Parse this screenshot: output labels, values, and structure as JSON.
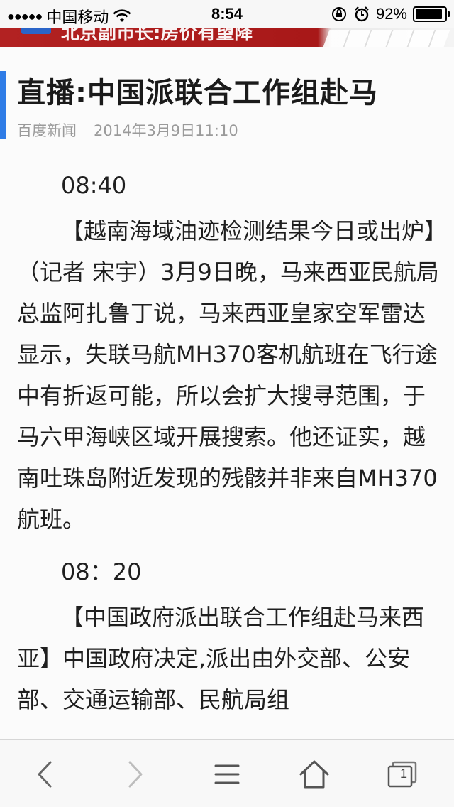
{
  "status_bar": {
    "carrier": "中国移动",
    "time": "8:54",
    "battery_percent_text": "92%",
    "battery_level": 0.92
  },
  "banner": {
    "text": "北京副市长:房价有望降"
  },
  "article": {
    "title": "直播:中国派联合工作组赴马",
    "source": "百度新闻",
    "date": "2014年3月9日11:10",
    "sections": [
      {
        "time": "08:40",
        "text": "【越南海域油迹检测结果今日或出炉】（记者 宋宇）3月9日晚，马来西亚民航局总监阿扎鲁丁说，马来西亚皇家空军雷达显示，失联马航MH370客机航班在飞行途中有折返可能，所以会扩大搜寻范围，于马六甲海峡区域开展搜索。他还证实，越南吐珠岛附近发现的残骸并非来自MH370航班。"
      },
      {
        "time": "08：20",
        "text": "【中国政府派出联合工作组赴马来西亚】中国政府决定,派出由外交部、公安部、交通运输部、民航局组"
      }
    ]
  },
  "toolbar": {
    "tab_count": "1",
    "accent": "#2f7ce6"
  }
}
